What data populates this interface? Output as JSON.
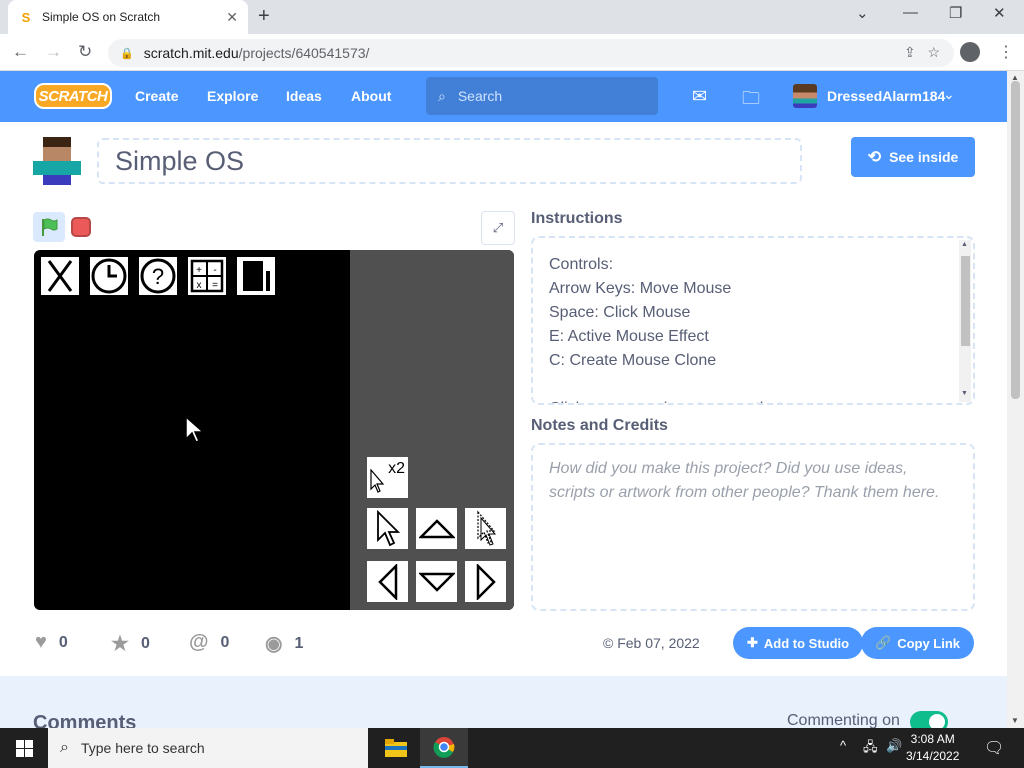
{
  "browser": {
    "tab_title": "Simple OS on Scratch",
    "url_host": "scratch.mit.edu",
    "url_path": "/projects/640541573/",
    "favicon": "S"
  },
  "nav": {
    "logo": "SCRATCH",
    "links": [
      "Create",
      "Explore",
      "Ideas",
      "About"
    ],
    "search_placeholder": "Search",
    "username": "DressedAlarm184"
  },
  "project": {
    "title": "Simple OS",
    "see_inside": "See inside",
    "instructions_heading": "Instructions",
    "instructions": [
      "Controls:",
      "Arrow Keys: Move Mouse",
      "Space: Click Mouse",
      "E: Active Mouse Effect",
      "C: Create Mouse Clone",
      "",
      "Click on an app icon to open that app."
    ],
    "notes_heading": "Notes and Credits",
    "notes_placeholder": "How did you make this project? Did you use ideas, scripts or artwork from other people? Thank them here.",
    "stage_badge": "x2"
  },
  "stats": {
    "loves": "0",
    "favorites": "0",
    "remixes": "0",
    "views": "1",
    "date": "© Feb 07, 2022",
    "add_to_studio": "Add to Studio",
    "copy_link": "Copy Link"
  },
  "comments": {
    "heading": "Comments",
    "commenting_label": "Commenting on",
    "commenting_enabled": true
  },
  "taskbar": {
    "search_placeholder": "Type here to search",
    "time": "3:08 AM",
    "date": "3/14/2022"
  },
  "colors": {
    "scratch_blue": "#4c97ff",
    "toggle_green": "#0fbd8c"
  }
}
